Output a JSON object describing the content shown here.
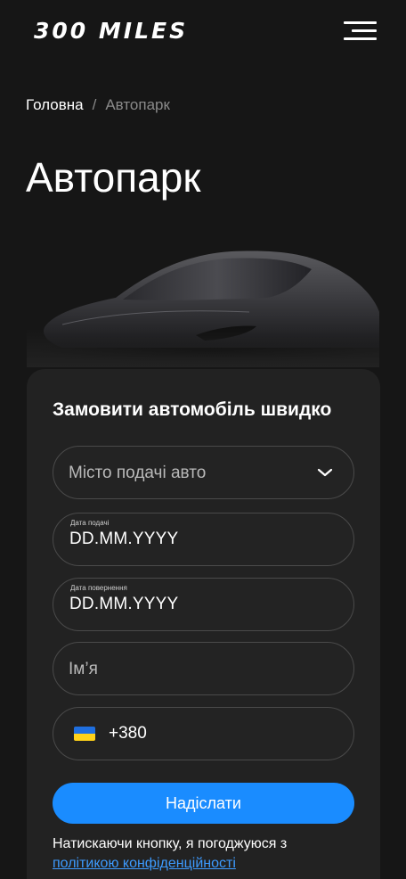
{
  "header": {
    "logo": "300 MILES",
    "menu_icon": "hamburger-menu-icon"
  },
  "breadcrumb": {
    "home": "Головна",
    "separator": "/",
    "current": "Автопарк"
  },
  "page": {
    "title": "Автопарк"
  },
  "form": {
    "title": "Замовити автомобіль швидко",
    "city_select": {
      "placeholder": "Місто подачі авто",
      "icon": "chevron-down-icon"
    },
    "pickup_date": {
      "label": "Дата подачі",
      "value": "DD.MM.YYYY"
    },
    "return_date": {
      "label": "Дата повернення",
      "value": "DD.MM.YYYY"
    },
    "name": {
      "placeholder": "Ім’я"
    },
    "phone": {
      "flag": "ukraine-flag-icon",
      "prefix": "+380"
    },
    "submit_label": "Надіслати",
    "consent_text": "Натискаючи кнопку, я погоджуюся з",
    "privacy_link": "політикою конфіденційності"
  },
  "colors": {
    "background": "#161616",
    "card": "#222222",
    "accent": "#1a8cff",
    "link": "#3d9bff"
  }
}
